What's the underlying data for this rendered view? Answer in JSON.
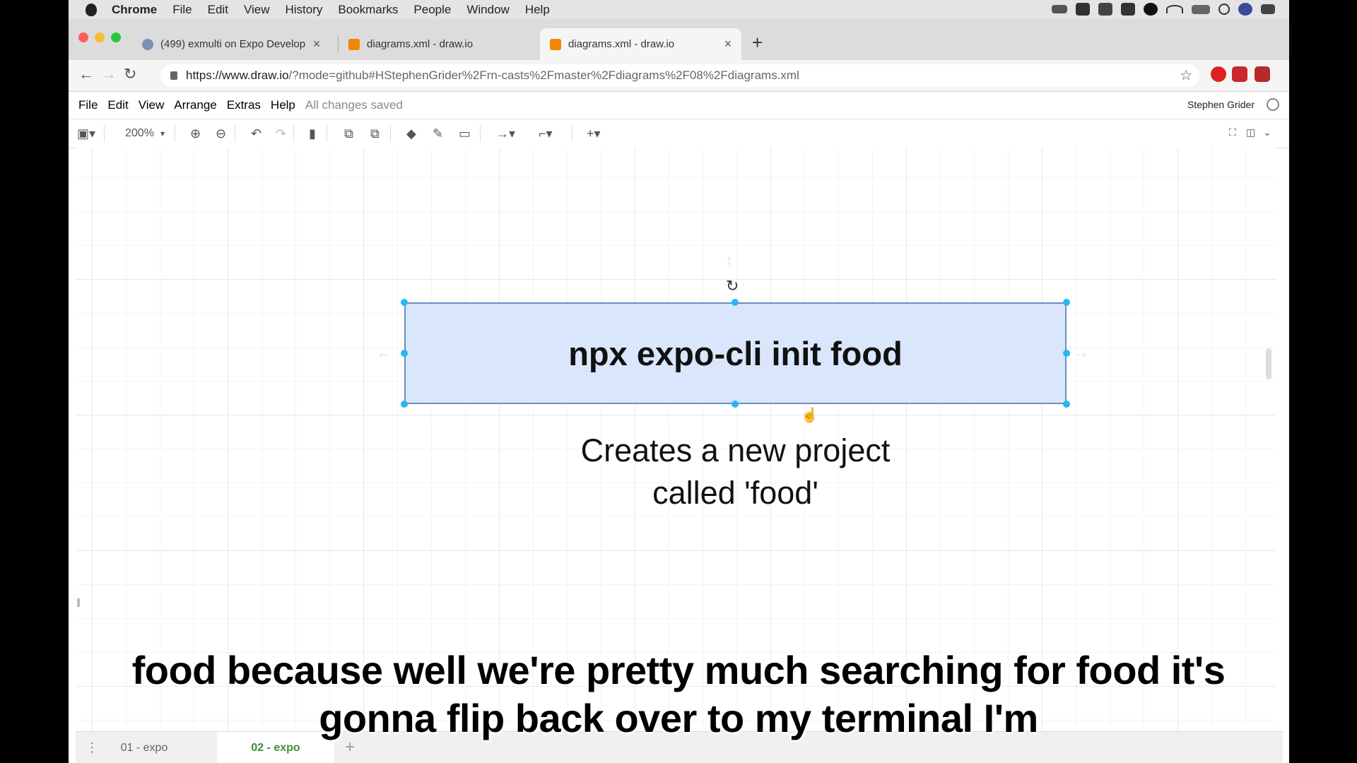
{
  "menubar": {
    "items": [
      "Chrome",
      "File",
      "Edit",
      "View",
      "History",
      "Bookmarks",
      "People",
      "Window",
      "Help"
    ]
  },
  "tabs": [
    {
      "label": "(499) exmulti on Expo Develop",
      "icon": "expo-icon",
      "state": "inactive"
    },
    {
      "label": "diagrams.xml - draw.io",
      "icon": "drawio-icon",
      "state": "inactive"
    },
    {
      "label": "diagrams.xml - draw.io",
      "icon": "drawio-icon",
      "state": "active"
    }
  ],
  "address": {
    "host": "https://www.draw.io",
    "path": "/?mode=github#HStephenGrider%2Frn-casts%2Fmaster%2Fdiagrams%2F08%2Fdiagrams.xml"
  },
  "appmenu": {
    "items": [
      "File",
      "Edit",
      "View",
      "Arrange",
      "Extras",
      "Help"
    ],
    "status": "All changes saved",
    "user": "Stephen Grider"
  },
  "toolbar": {
    "zoom": "200%"
  },
  "diagram": {
    "shape_text": "npx expo-cli init food",
    "caption_line1": "Creates a new project",
    "caption_line2": "called 'food'"
  },
  "pages": {
    "tabs": [
      {
        "label": "01 - expo",
        "state": "inactive"
      },
      {
        "label": "02 - expo",
        "state": "active"
      }
    ]
  },
  "subtitle": {
    "line1": "food because well we're pretty much searching for food it's",
    "line2": "gonna flip back over to my terminal I'm"
  },
  "colors": {
    "shape_fill": "#dae6fb",
    "shape_stroke": "#6c8ebf",
    "selection_handle": "#29b6f2",
    "active_page_tab": "#3a8f3a"
  }
}
